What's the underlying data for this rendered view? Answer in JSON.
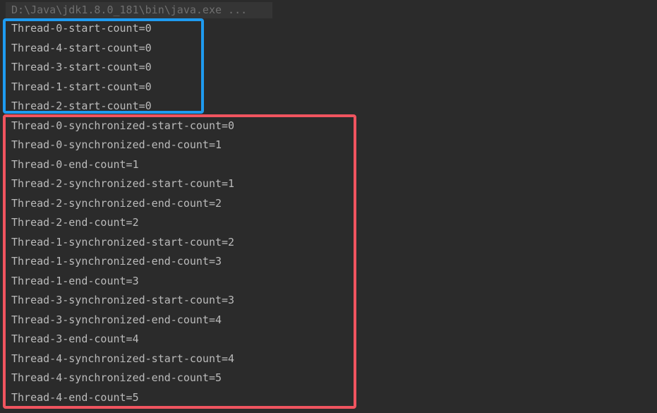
{
  "console": {
    "command": "D:\\Java\\jdk1.8.0_181\\bin\\java.exe ...",
    "start_lines": [
      "Thread-0-start-count=0",
      "Thread-4-start-count=0",
      "Thread-3-start-count=0",
      "Thread-1-start-count=0",
      "Thread-2-start-count=0"
    ],
    "sync_lines": [
      "Thread-0-synchronized-start-count=0",
      "Thread-0-synchronized-end-count=1",
      "Thread-0-end-count=1",
      "Thread-2-synchronized-start-count=1",
      "Thread-2-synchronized-end-count=2",
      "Thread-2-end-count=2",
      "Thread-1-synchronized-start-count=2",
      "Thread-1-synchronized-end-count=3",
      "Thread-1-end-count=3",
      "Thread-3-synchronized-start-count=3",
      "Thread-3-synchronized-end-count=4",
      "Thread-3-end-count=4",
      "Thread-4-synchronized-start-count=4",
      "Thread-4-synchronized-end-count=5",
      "Thread-4-end-count=5"
    ]
  },
  "colors": {
    "background": "#2b2b2b",
    "text": "#bbbbbb",
    "command_text": "#6f6f6f",
    "highlight_blue": "#1e9bf0",
    "highlight_red": "#f0545f"
  }
}
